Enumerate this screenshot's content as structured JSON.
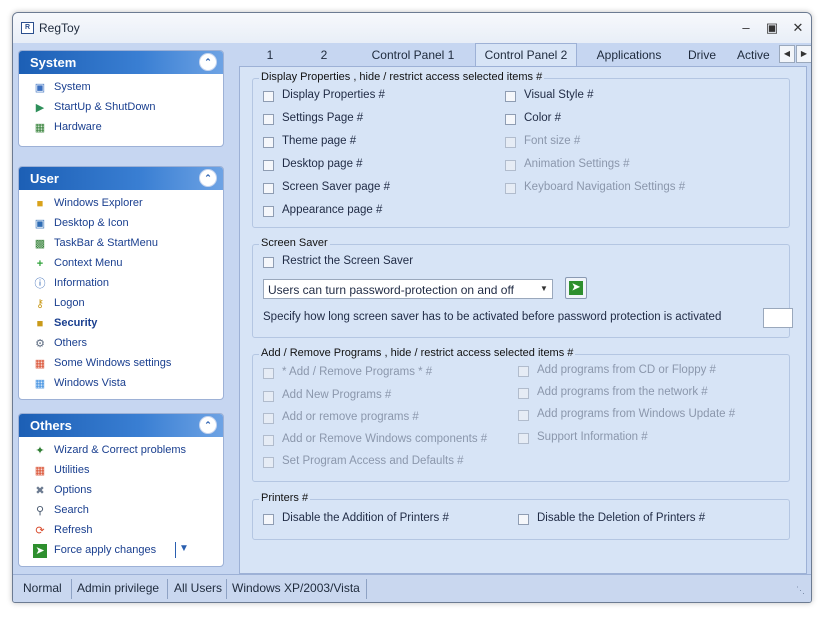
{
  "window": {
    "title": "RegToy",
    "app_icon": "regtoy-app-icon",
    "buttons": [
      "minimize",
      "maximize",
      "close"
    ]
  },
  "sidebar": {
    "system": {
      "title": "System",
      "items": [
        {
          "label": "System",
          "icon": "computer-icon"
        },
        {
          "label": "StartUp & ShutDown",
          "icon": "startup-icon"
        },
        {
          "label": "Hardware",
          "icon": "hardware-icon"
        }
      ]
    },
    "user": {
      "title": "User",
      "items": [
        {
          "label": "Windows Explorer",
          "icon": "folder-icon"
        },
        {
          "label": "Desktop & Icon",
          "icon": "desktop-icon"
        },
        {
          "label": "TaskBar & StartMenu",
          "icon": "taskbar-icon"
        },
        {
          "label": "Context Menu",
          "icon": "plus-icon"
        },
        {
          "label": "Information",
          "icon": "info-icon"
        },
        {
          "label": "Logon",
          "icon": "key-icon"
        },
        {
          "label": "Security",
          "icon": "lock-icon"
        },
        {
          "label": "Others",
          "icon": "gear-icon"
        },
        {
          "label": "Some Windows settings",
          "icon": "windows-flag-icon"
        },
        {
          "label": "Windows Vista",
          "icon": "windows-flag-icon"
        }
      ]
    },
    "others": {
      "title": "Others",
      "items": [
        {
          "label": "Wizard & Correct problems",
          "icon": "wizard-icon"
        },
        {
          "label": "Utilities",
          "icon": "utilities-icon"
        },
        {
          "label": "Options",
          "icon": "options-icon"
        },
        {
          "label": "Search",
          "icon": "search-icon"
        },
        {
          "label": "Refresh",
          "icon": "refresh-icon"
        },
        {
          "label": "Force apply changes",
          "icon": "apply-arrow-icon"
        }
      ]
    }
  },
  "tabs": [
    "1",
    "2",
    "Control Panel 1",
    "Control Panel 2",
    "Applications",
    "Drive",
    "Active"
  ],
  "active_tab": "Control Panel 2",
  "display": {
    "title": "Display Properties , hide / restrict access selected items #",
    "left": [
      {
        "label": "Display Properties #",
        "enabled": true
      },
      {
        "label": "Settings Page #",
        "enabled": true
      },
      {
        "label": "Theme page #",
        "enabled": true
      },
      {
        "label": "Desktop page #",
        "enabled": true
      },
      {
        "label": "Screen Saver page #",
        "enabled": true
      },
      {
        "label": "Appearance page #",
        "enabled": true
      }
    ],
    "right": [
      {
        "label": "Visual Style #",
        "enabled": true
      },
      {
        "label": "Color #",
        "enabled": true
      },
      {
        "label": "Font size #",
        "enabled": false
      },
      {
        "label": "Animation Settings #",
        "enabled": false
      },
      {
        "label": "Keyboard Navigation Settings #",
        "enabled": false
      }
    ]
  },
  "screensaver": {
    "title": "Screen Saver",
    "restrict_label": "Restrict the Screen Saver",
    "dropdown_value": "Users can turn password-protection on and off",
    "description": "Specify how long screen saver has to be activated before password protection is activated",
    "delay_value": ""
  },
  "addremove": {
    "title": "Add / Remove Programs , hide / restrict access selected items #",
    "left": [
      {
        "label": "* Add / Remove Programs * #"
      },
      {
        "label": "Add New Programs #"
      },
      {
        "label": "Add or remove programs #"
      },
      {
        "label": "Add or Remove Windows components #"
      },
      {
        "label": "Set Program Access and Defaults #"
      }
    ],
    "right": [
      {
        "label": "Add programs from CD or Floppy #"
      },
      {
        "label": "Add programs from the network #"
      },
      {
        "label": "Add programs from Windows Update #"
      },
      {
        "label": "Support Information #"
      }
    ]
  },
  "printers": {
    "title": "Printers #",
    "items": [
      "Disable the Addition of Printers #",
      "Disable the Deletion of Printers #"
    ]
  },
  "statusbar": {
    "mode": "Normal",
    "privilege": "Admin privilege",
    "scope": "All Users",
    "os": "Windows XP/2003/Vista"
  }
}
